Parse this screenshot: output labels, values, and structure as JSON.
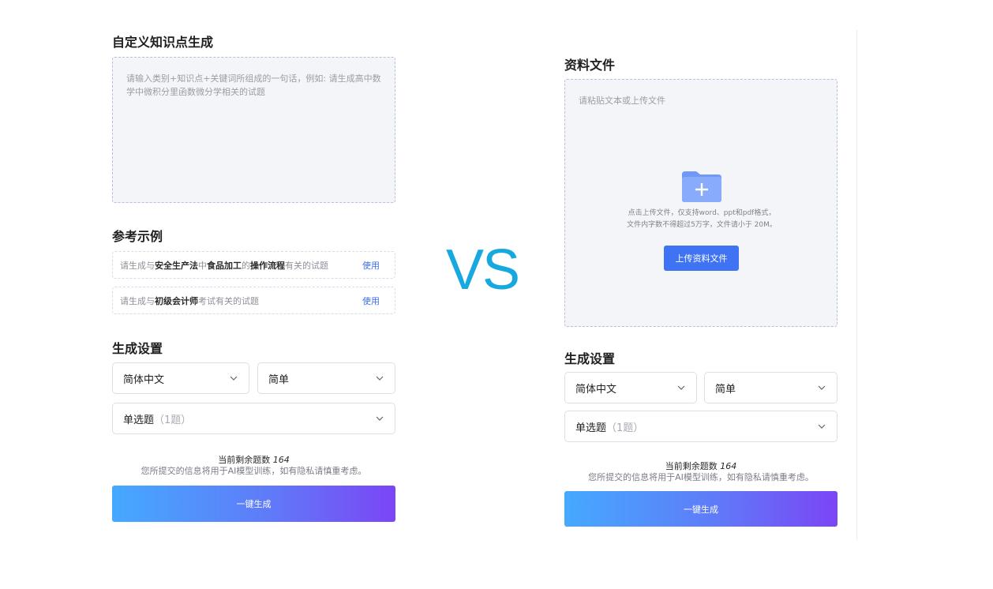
{
  "left": {
    "title": "自定义知识点生成",
    "placeholder": "请输入类别+知识点+关键词所组成的一句话，例如: 请生成高中数学中微积分里函数微分学相关的试题",
    "examples_title": "参考示例",
    "examples": [
      {
        "parts": [
          "请生成与",
          "安全生产法",
          "中",
          "食品加工",
          "的",
          "操作流程",
          "有关的试题"
        ],
        "action": "使用"
      },
      {
        "parts": [
          "请生成与",
          "初级会计师",
          "考试有关的试题"
        ],
        "action": "使用"
      }
    ],
    "settings_title": "生成设置",
    "language": "简体中文",
    "difficulty": "简单",
    "question_type": "单选题",
    "question_count": "（1题）",
    "remaining_label": "当前剩余题数",
    "remaining_count": "164",
    "notice": "您所提交的信息将用于AI模型训练，如有隐私请慎重考虑。",
    "generate_label": "一键生成"
  },
  "vs": "VS",
  "right": {
    "title": "资料文件",
    "placeholder": "请粘贴文本或上传文件",
    "upload_hint": "点击上传文件，仅支持word、ppt和pdf格式，文件内字数不得超过5万字，文件请小于 20M。",
    "upload_button": "上传资料文件",
    "settings_title": "生成设置",
    "language": "简体中文",
    "difficulty": "简单",
    "question_type": "单选题",
    "question_count": "（1题）",
    "remaining_label": "当前剩余题数",
    "remaining_count": "164",
    "notice": "您所提交的信息将用于AI模型训练，如有隐私请慎重考虑。",
    "generate_label": "一键生成"
  },
  "colors": {
    "accent_blue": "#3f73f4",
    "vs_blue": "#18a8e0",
    "gradient_start": "#45a9ff",
    "gradient_end": "#7b45f6"
  }
}
